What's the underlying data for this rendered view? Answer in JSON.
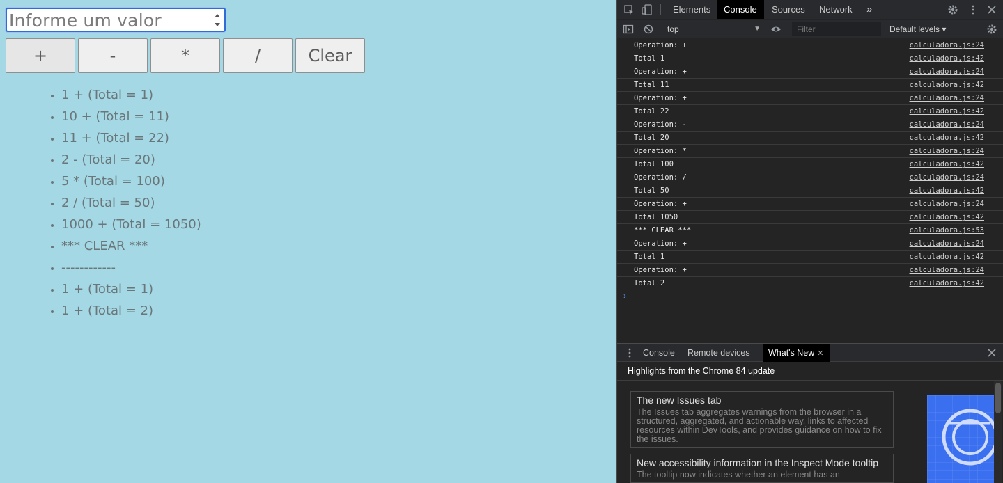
{
  "app": {
    "input": {
      "placeholder": "Informe um valor"
    },
    "buttons": [
      {
        "label": "+"
      },
      {
        "label": "-"
      },
      {
        "label": "*"
      },
      {
        "label": "/"
      },
      {
        "label": "Clear"
      }
    ],
    "history": [
      "1 + (Total = 1)",
      "10 + (Total = 11)",
      "11 + (Total = 22)",
      "2 - (Total = 20)",
      "5 * (Total = 100)",
      "2 / (Total = 50)",
      "1000 + (Total = 1050)",
      "*** CLEAR ***",
      "------------",
      "1 + (Total = 1)",
      "1 + (Total = 2)"
    ]
  },
  "devtools": {
    "tabs": [
      "Elements",
      "Console",
      "Sources",
      "Network"
    ],
    "more_tabs": "»",
    "active_tab": "Console",
    "toolbar": {
      "context": "top",
      "filter_placeholder": "Filter",
      "levels": "Default levels ▾"
    },
    "console_logs": [
      {
        "message": "Operation: +",
        "source": "calculadora.js:24"
      },
      {
        "message": "Total 1",
        "source": "calculadora.js:42"
      },
      {
        "message": "Operation: +",
        "source": "calculadora.js:24"
      },
      {
        "message": "Total 11",
        "source": "calculadora.js:42"
      },
      {
        "message": "Operation: +",
        "source": "calculadora.js:24"
      },
      {
        "message": "Total 22",
        "source": "calculadora.js:42"
      },
      {
        "message": "Operation: -",
        "source": "calculadora.js:24"
      },
      {
        "message": "Total 20",
        "source": "calculadora.js:42"
      },
      {
        "message": "Operation: *",
        "source": "calculadora.js:24"
      },
      {
        "message": "Total 100",
        "source": "calculadora.js:42"
      },
      {
        "message": "Operation: /",
        "source": "calculadora.js:24"
      },
      {
        "message": "Total 50",
        "source": "calculadora.js:42"
      },
      {
        "message": "Operation: +",
        "source": "calculadora.js:24"
      },
      {
        "message": "Total 1050",
        "source": "calculadora.js:42"
      },
      {
        "message": "*** CLEAR ***",
        "source": "calculadora.js:53"
      },
      {
        "message": "Operation: +",
        "source": "calculadora.js:24"
      },
      {
        "message": "Total 1",
        "source": "calculadora.js:42"
      },
      {
        "message": "Operation: +",
        "source": "calculadora.js:24"
      },
      {
        "message": "Total 2",
        "source": "calculadora.js:42"
      }
    ],
    "drawer": {
      "tabs": [
        "Console",
        "Remote devices",
        "What's New"
      ],
      "active_tab": "What's New",
      "highlights_title": "Highlights from the Chrome 84 update",
      "cards": [
        {
          "title": "The new Issues tab",
          "description": "The Issues tab aggregates warnings from the browser in a structured, aggregated, and actionable way, links to affected resources within DevTools, and provides guidance on how to fix the issues."
        },
        {
          "title": "New accessibility information in the Inspect Mode tooltip",
          "description": "The tooltip now indicates whether an element has an"
        }
      ]
    }
  }
}
